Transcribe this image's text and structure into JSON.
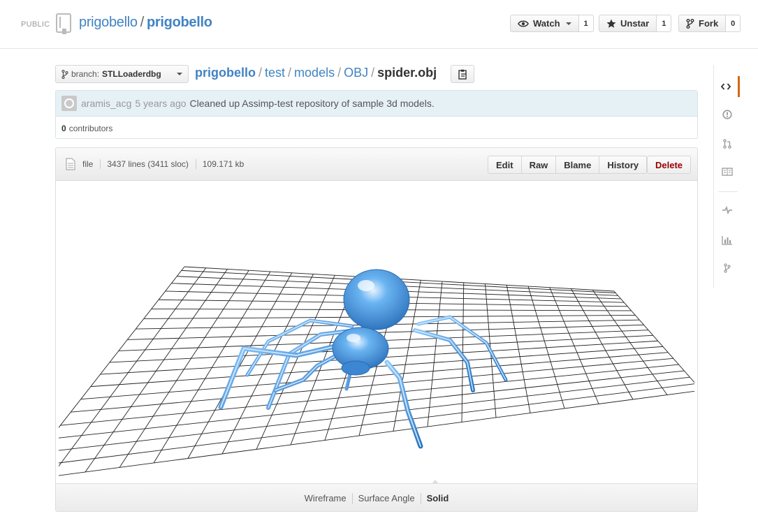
{
  "header": {
    "visibility": "PUBLIC",
    "owner": "prigobello",
    "separator": "/",
    "repo": "prigobello",
    "watch": {
      "label": "Watch",
      "count": "1"
    },
    "star": {
      "label": "Unstar",
      "count": "1"
    },
    "fork": {
      "label": "Fork",
      "count": "0"
    }
  },
  "breadcrumb": {
    "branch_prefix": "branch:",
    "branch": "STLLoaderdbg",
    "root": "prigobello",
    "parts": [
      "test",
      "models",
      "OBJ"
    ],
    "final": "spider.obj",
    "sep": "/"
  },
  "commit": {
    "author": "aramis_acg",
    "time": "5 years ago",
    "message": "Cleaned up Assimp-test repository of sample 3d models.",
    "contributors_count": "0",
    "contributors_label": "contributors"
  },
  "file": {
    "type": "file",
    "lines": "3437 lines (3411 sloc)",
    "size": "109.171 kb",
    "actions": {
      "edit": "Edit",
      "raw": "Raw",
      "blame": "Blame",
      "history": "History",
      "delete": "Delete"
    }
  },
  "viewer": {
    "modes": [
      "Wireframe",
      "Surface Angle",
      "Solid"
    ],
    "active_mode": "Solid",
    "model_color": "#4a9be0"
  },
  "nav": {
    "items": [
      "code-icon",
      "issues-icon",
      "pull-requests-icon",
      "wiki-icon",
      "pulse-icon",
      "graphs-icon",
      "network-icon"
    ],
    "selected": "code-icon",
    "accent": "#d26911"
  }
}
